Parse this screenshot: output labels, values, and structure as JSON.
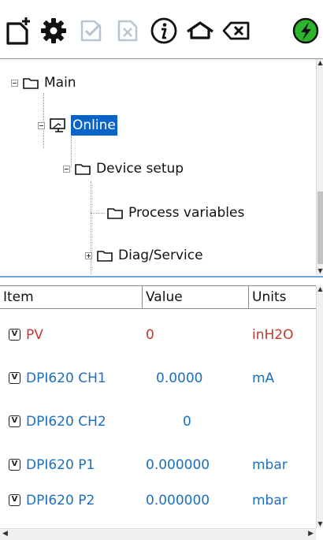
{
  "toolbar": {
    "buttons": [
      {
        "icon": "new-document-icon",
        "enabled": true
      },
      {
        "icon": "gear-icon",
        "enabled": true
      },
      {
        "icon": "check-document-icon",
        "enabled": false
      },
      {
        "icon": "cancel-document-icon",
        "enabled": false
      },
      {
        "icon": "info-icon",
        "enabled": true
      },
      {
        "icon": "home-icon",
        "enabled": true
      },
      {
        "icon": "backspace-icon",
        "enabled": true
      },
      {
        "icon": "connection-status-icon",
        "enabled": true
      }
    ]
  },
  "tree": {
    "nodes": [
      {
        "label": "Main",
        "expander": "minus",
        "icon": "folder-icon"
      },
      {
        "label": "Online",
        "expander": "minus",
        "icon": "computer-icon",
        "selected": true
      },
      {
        "label": "Device setup",
        "expander": "minus",
        "icon": "folder-icon"
      },
      {
        "label": "Process variables",
        "expander": "none",
        "icon": "folder-icon"
      },
      {
        "label": "Diag/Service",
        "expander": "plus",
        "icon": "folder-icon"
      }
    ]
  },
  "grid": {
    "columns": [
      "Item",
      "Value",
      "Units"
    ],
    "badge": "V",
    "rows": [
      {
        "item": "PV",
        "value": "0",
        "units": "inH2O",
        "color": "#c0392b"
      },
      {
        "item": "DPI620 CH1",
        "value": "0.0000",
        "units": "mA",
        "color": "#1a6fc2"
      },
      {
        "item": "DPI620 CH2",
        "value": "0",
        "units": "",
        "color": "#1a6fc2"
      },
      {
        "item": "DPI620 P1",
        "value": "0.000000",
        "units": "mbar",
        "color": "#1a6fc2"
      },
      {
        "item": "DPI620 P2",
        "value": "0.000000",
        "units": "mbar",
        "color": "#1a6fc2"
      }
    ]
  },
  "colors": {
    "selection": "#0a64c8",
    "accent_blue": "#1a6fc2",
    "accent_red": "#c0392b",
    "status_green": "#2db52d",
    "disabled_icon": "#b8c3d4"
  }
}
